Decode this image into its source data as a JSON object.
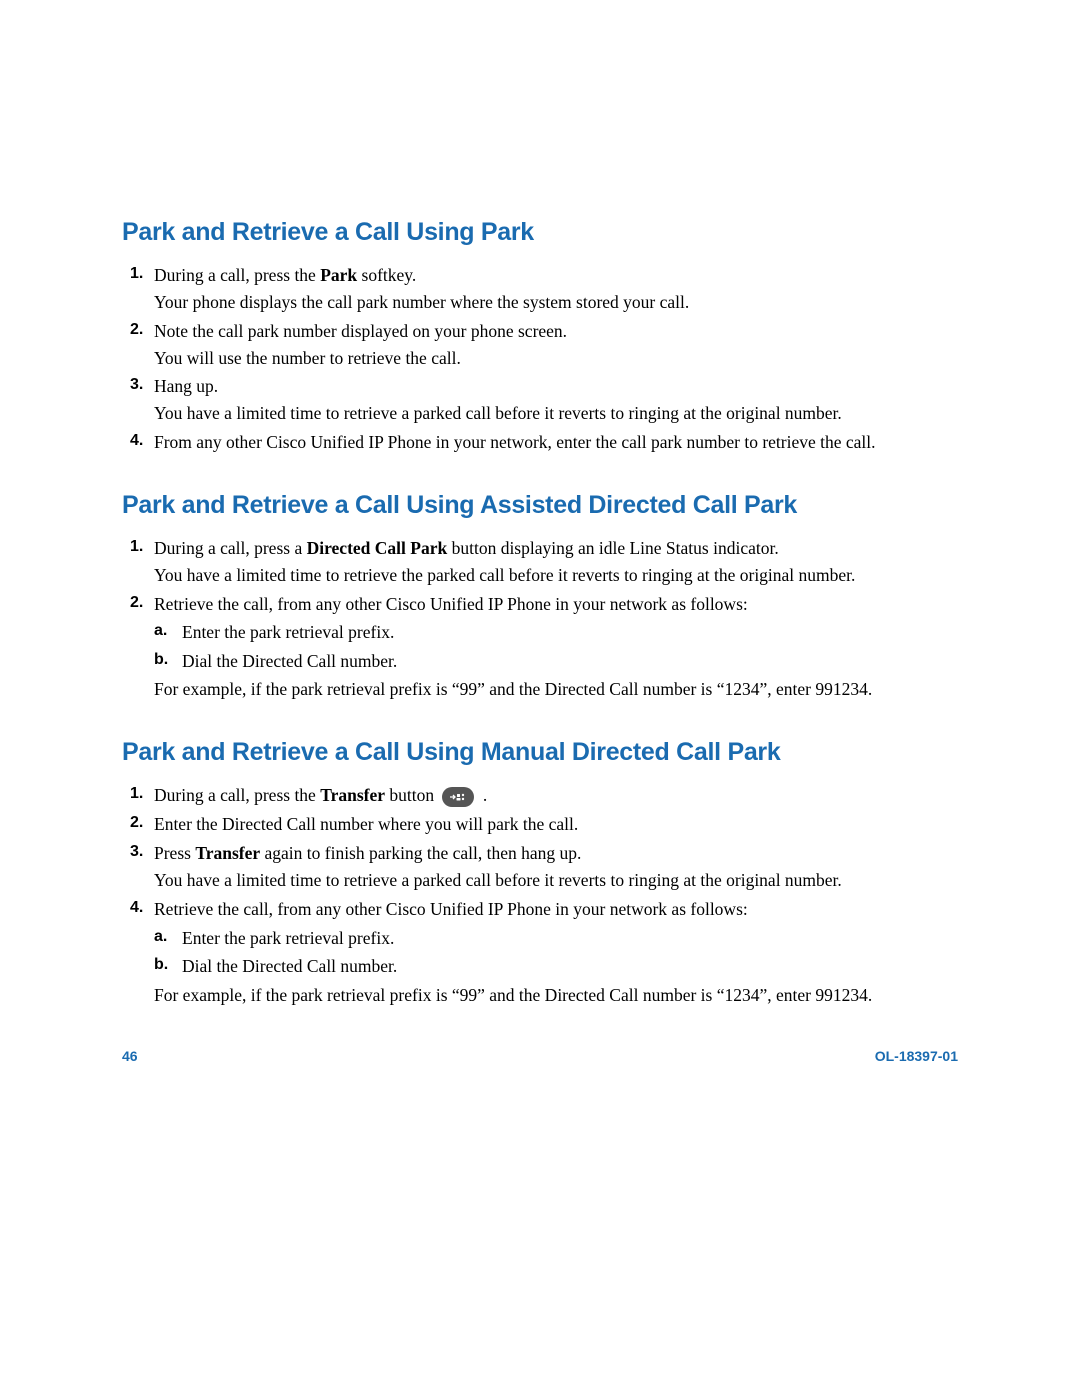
{
  "sections": {
    "s1": {
      "heading": "Park and Retrieve a Call Using Park",
      "items": {
        "i1": {
          "line1_pre": "During a call, press the ",
          "line1_bold": "Park",
          "line1_post": " softkey.",
          "line2": "Your phone displays the call park number where the system stored your call."
        },
        "i2": {
          "line1": "Note the call park number displayed on your phone screen.",
          "line2": "You will use the number to retrieve the call."
        },
        "i3": {
          "line1": "Hang up.",
          "line2": "You have a limited time to retrieve a parked call before it reverts to ringing at the original number."
        },
        "i4": {
          "line1": "From any other Cisco Unified IP Phone in your network, enter the call park number to retrieve the call."
        }
      }
    },
    "s2": {
      "heading": "Park and Retrieve a Call Using Assisted Directed Call Park",
      "items": {
        "i1": {
          "line1_pre": "During a call, press a ",
          "line1_bold": "Directed Call Park",
          "line1_post": " button displaying an idle Line Status indicator.",
          "line2": "You have a limited time to retrieve the parked call before it reverts to ringing at the original number."
        },
        "i2": {
          "line1": "Retrieve the call, from any other Cisco Unified IP Phone in your network as follows:",
          "sub": {
            "a": "Enter the park retrieval prefix.",
            "b": "Dial the Directed Call number."
          },
          "line3": "For example, if the park retrieval prefix is “99” and the Directed Call number is “1234”, enter 991234."
        }
      }
    },
    "s3": {
      "heading": "Park and Retrieve a Call Using Manual Directed Call Park",
      "items": {
        "i1": {
          "line1_pre": "During a call, press the ",
          "line1_bold": "Transfer",
          "line1_post": " button ",
          "line1_end": " ."
        },
        "i2": {
          "line1": "Enter the Directed Call number where you will park the call."
        },
        "i3": {
          "line1_pre": "Press ",
          "line1_bold": "Transfer",
          "line1_post": " again to finish parking the call, then hang up.",
          "line2": "You have a limited time to retrieve a parked call before it reverts to ringing at the original number."
        },
        "i4": {
          "line1": "Retrieve the call, from any other Cisco Unified IP Phone in your network as follows:",
          "sub": {
            "a": "Enter the park retrieval prefix.",
            "b": "Dial the Directed Call number."
          },
          "line3": "For example, if the park retrieval prefix is “99” and the Directed Call number is “1234”, enter 991234."
        }
      }
    }
  },
  "footer": {
    "page": "46",
    "docid": "OL-18397-01"
  }
}
